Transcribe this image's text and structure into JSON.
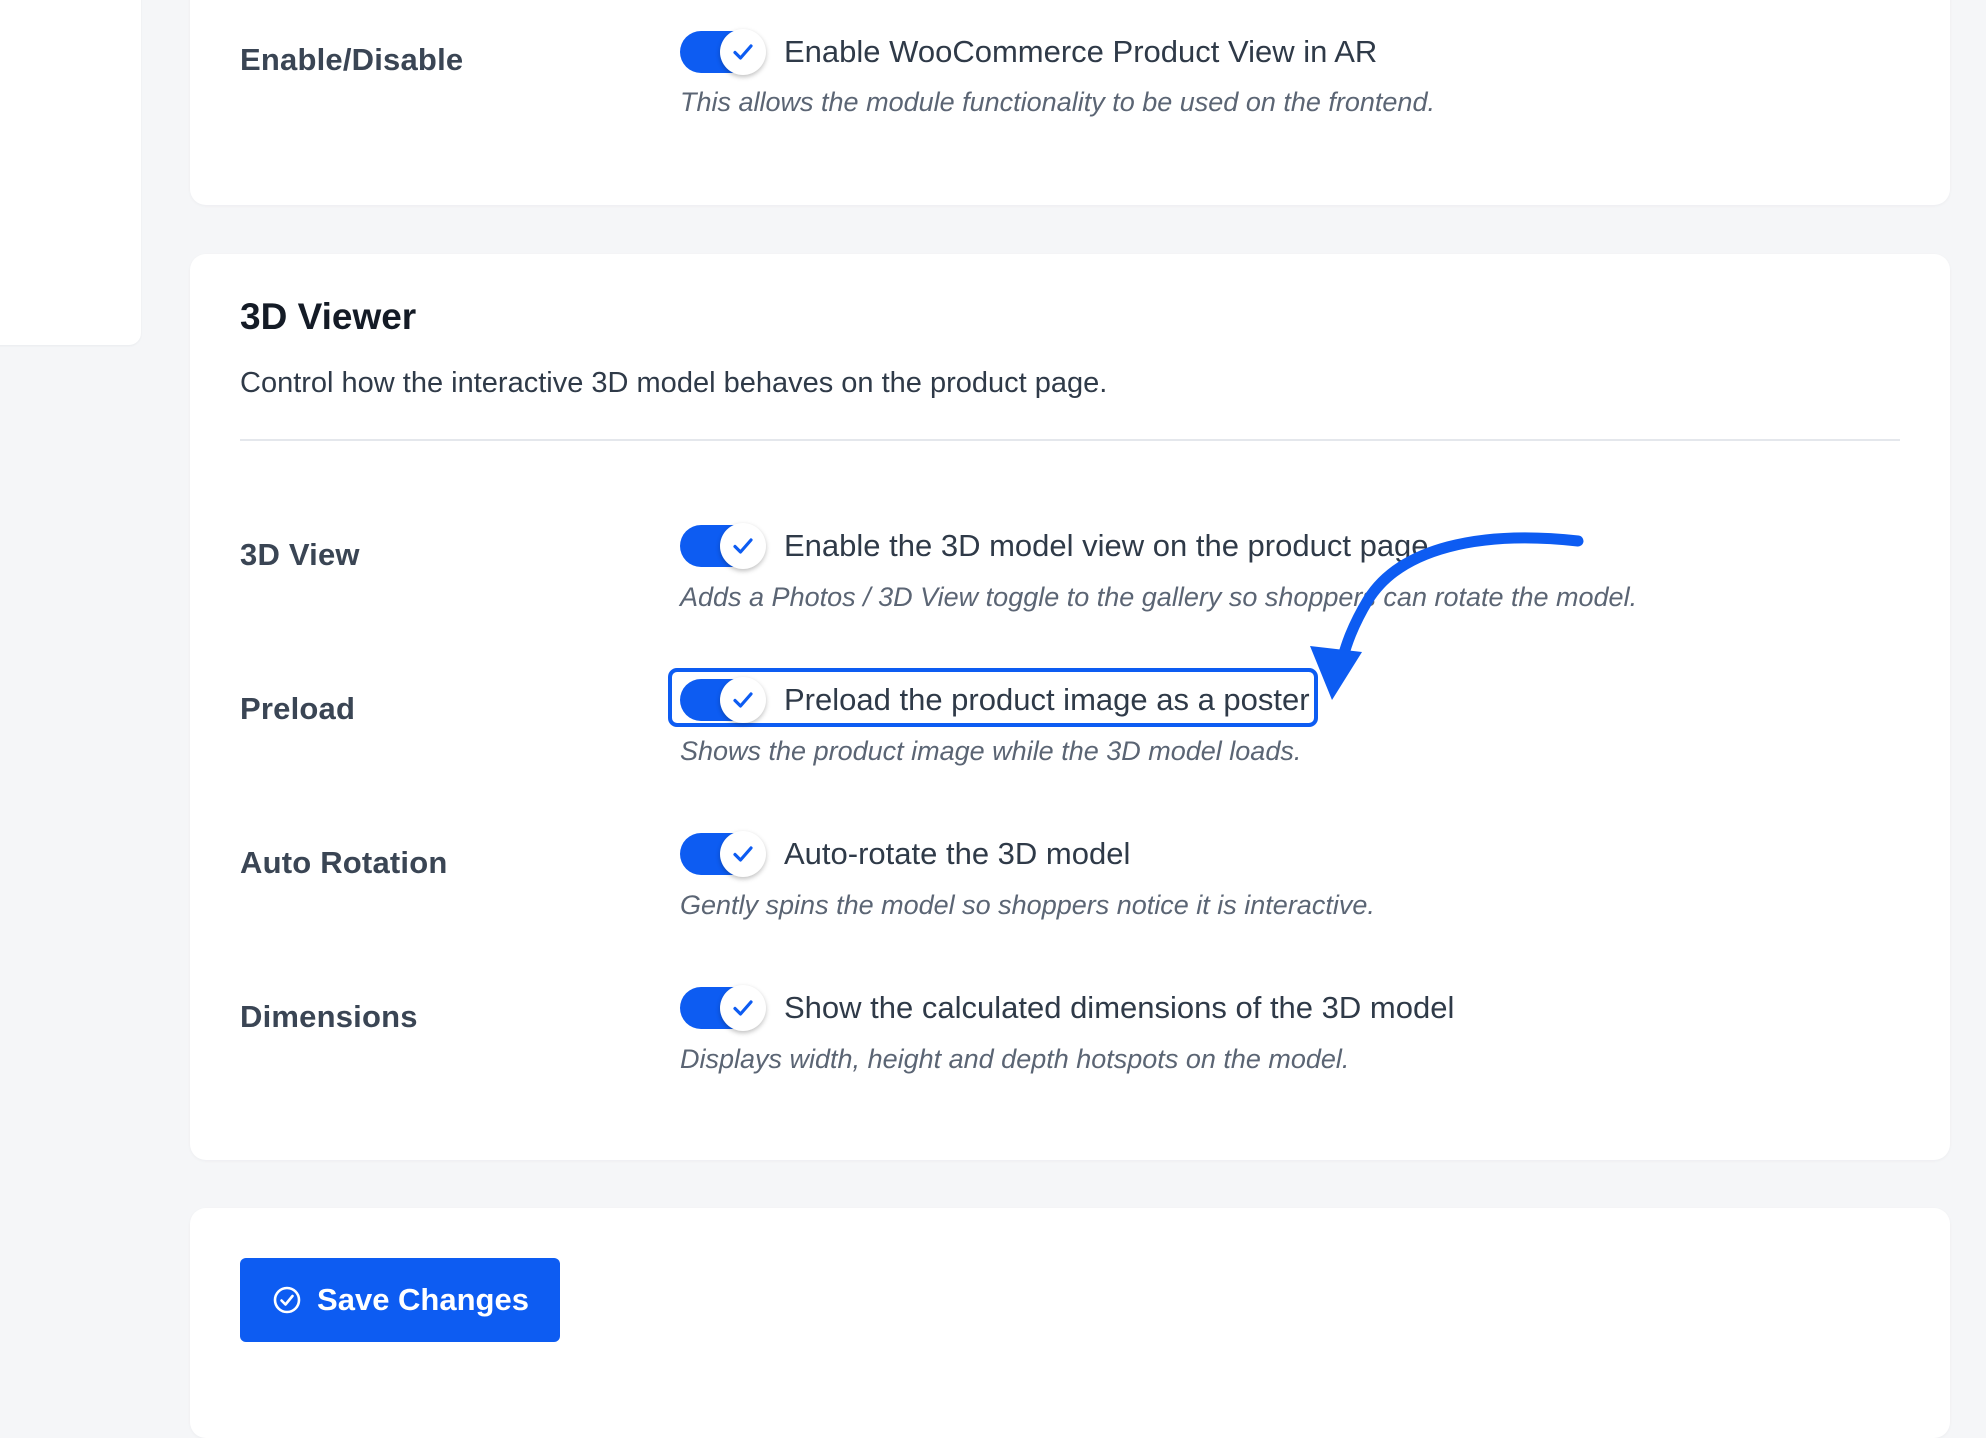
{
  "general": {
    "enable_label": "Enable/Disable",
    "enable_option": "Enable WooCommerce Product View in AR",
    "enable_desc": "This allows the module functionality to be used on the frontend.",
    "enable_on": true
  },
  "viewer": {
    "title": "3D Viewer",
    "subtitle": "Control how the interactive 3D model behaves on the product page.",
    "rows": [
      {
        "label": "3D View",
        "option": "Enable the 3D model view on the product page",
        "desc": "Adds a Photos / 3D View toggle to the gallery so shoppers can rotate the model.",
        "on": true
      },
      {
        "label": "Preload",
        "option": "Preload the product image as a poster",
        "desc": "Shows the product image while the 3D model loads.",
        "on": true,
        "highlighted": true
      },
      {
        "label": "Auto Rotation",
        "option": "Auto-rotate the 3D model",
        "desc": "Gently spins the model so shoppers notice it is interactive.",
        "on": true
      },
      {
        "label": "Dimensions",
        "option": "Show the calculated dimensions of the 3D model",
        "desc": "Displays width, height and depth hotspots on the model.",
        "on": true
      }
    ]
  },
  "footer": {
    "save_label": "Save Changes"
  },
  "icons": {
    "toggle_check": "check-icon",
    "save": "check-circle-icon",
    "annotation": "curved-arrow-icon"
  },
  "colors": {
    "accent": "#0d5cf2",
    "background": "#f5f6f8",
    "card": "#ffffff"
  }
}
